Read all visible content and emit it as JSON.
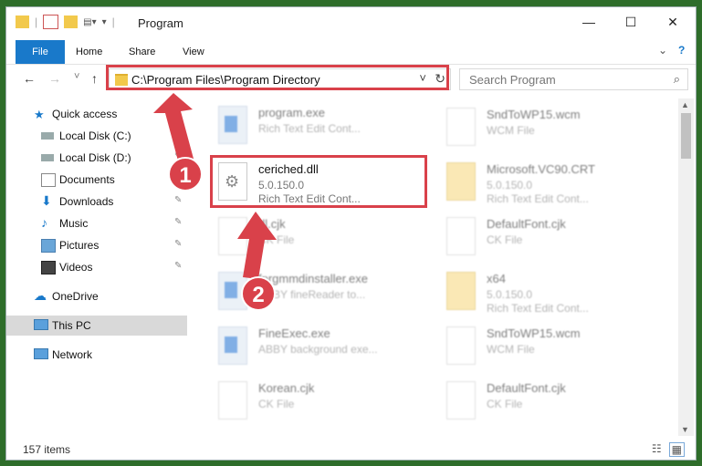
{
  "window": {
    "title": "Program",
    "minimize": "—",
    "maximize": "☐",
    "close": "✕"
  },
  "ribbon": {
    "tabs": [
      "File",
      "Home",
      "Share",
      "View"
    ],
    "expand": "⌄",
    "help": "?"
  },
  "nav": {
    "back": "←",
    "forward": "→",
    "recent": "˅",
    "up": "↑",
    "address": "C:\\Program Files\\Program Directory",
    "address_dropdown": "˅",
    "refresh": "↻",
    "search_placeholder": "Search Program",
    "search_icon": "⌕"
  },
  "sidebar": {
    "items": [
      {
        "label": "Quick access",
        "icon": "star-icon",
        "pinned": false
      },
      {
        "label": "Local Disk (C:)",
        "icon": "drive-icon",
        "pinned": true
      },
      {
        "label": "Local Disk (D:)",
        "icon": "drive-icon",
        "pinned": true
      },
      {
        "label": "Documents",
        "icon": "documents-icon",
        "pinned": true
      },
      {
        "label": "Downloads",
        "icon": "download-icon",
        "pinned": true
      },
      {
        "label": "Music",
        "icon": "music-icon",
        "pinned": true
      },
      {
        "label": "Pictures",
        "icon": "pictures-icon",
        "pinned": true
      },
      {
        "label": "Videos",
        "icon": "videos-icon",
        "pinned": true
      },
      {
        "label": "OneDrive",
        "icon": "cloud-icon",
        "pinned": false
      },
      {
        "label": "This PC",
        "icon": "computer-icon",
        "pinned": false
      },
      {
        "label": "Network",
        "icon": "network-icon",
        "pinned": false
      }
    ],
    "pin_glyph": "📌"
  },
  "files": {
    "left": [
      {
        "name": "program.exe",
        "line2": "Rich Text Edit Cont...",
        "line3": "",
        "type": "exe"
      },
      {
        "name": "ceriched.dll",
        "line2": "5.0.150.0",
        "line3": "Rich Text Edit Cont...",
        "type": "dll"
      },
      {
        "name": "dl.cjk",
        "line2": "CK File",
        "line3": "",
        "type": "file"
      },
      {
        "name": "fprgmmdinstaller.exe",
        "line2": "ABBY fineReader to...",
        "line3": "",
        "type": "exe"
      },
      {
        "name": "FineExec.exe",
        "line2": "ABBY background exe...",
        "line3": "",
        "type": "exe"
      },
      {
        "name": "Korean.cjk",
        "line2": "CK File",
        "line3": "",
        "type": "file"
      }
    ],
    "right": [
      {
        "name": "SndToWP15.wcm",
        "line2": "WCM File",
        "line3": "",
        "type": "file"
      },
      {
        "name": "Microsoft.VC90.CRT",
        "line2": "5.0.150.0",
        "line3": "Rich Text Edit Cont...",
        "type": "folder"
      },
      {
        "name": "DefaultFont.cjk",
        "line2": "CK File",
        "line3": "",
        "type": "file"
      },
      {
        "name": "x64",
        "line2": "5.0.150.0",
        "line3": "Rich Text Edit Cont...",
        "type": "folder"
      },
      {
        "name": "SndToWP15.wcm",
        "line2": "WCM File",
        "line3": "",
        "type": "file"
      },
      {
        "name": "DefaultFont.cjk",
        "line2": "CK File",
        "line3": "",
        "type": "file"
      }
    ]
  },
  "status": {
    "count": "157 items"
  },
  "annotations": {
    "badge1": "1",
    "badge2": "2",
    "color": "#d9414a"
  },
  "colors": {
    "file_tab": "#1979ca",
    "selection": "#d9d9d9"
  }
}
